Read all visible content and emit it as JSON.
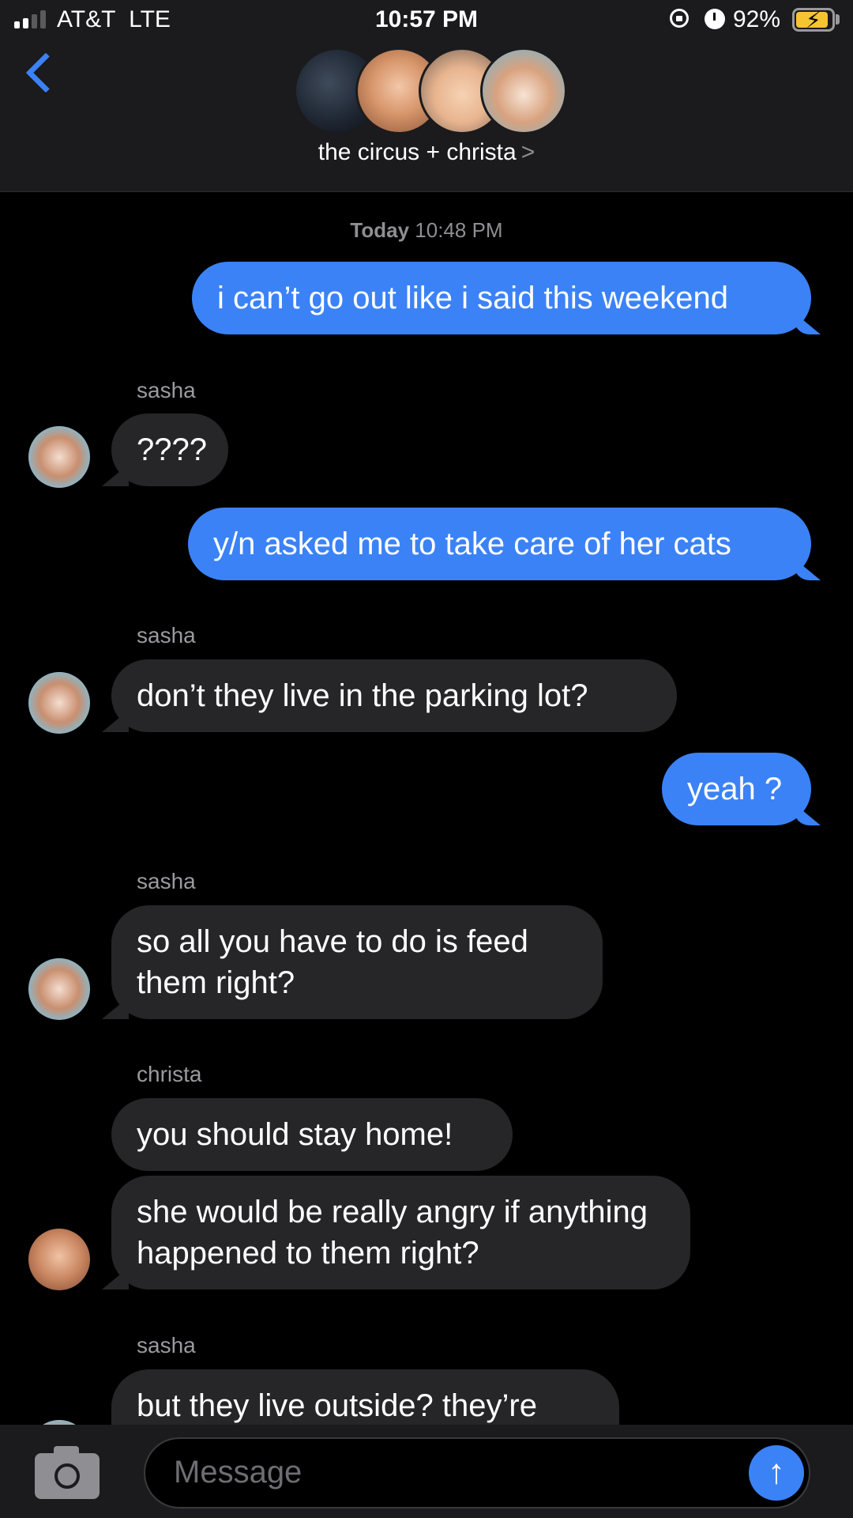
{
  "status_bar": {
    "carrier": "AT&T",
    "network": "LTE",
    "time": "10:57 PM",
    "battery_percent": "92%",
    "battery_level": 0.92,
    "battery_color": "#f5c531"
  },
  "header": {
    "back_icon": "chevron-left-icon",
    "group_name": "the circus + christa",
    "chevron": ">"
  },
  "thread": {
    "timestamp_day": "Today",
    "timestamp_time": "10:48 PM",
    "messages": [
      {
        "dir": "out",
        "text": "i can’t go out like i said this weekend"
      },
      {
        "dir": "in",
        "sender": "sasha",
        "text": "????"
      },
      {
        "dir": "out",
        "text": "y/n asked me to take care of her cats"
      },
      {
        "dir": "in",
        "sender": "sasha",
        "text": "don’t they live in the parking lot?"
      },
      {
        "dir": "out",
        "text": "yeah ?"
      },
      {
        "dir": "in",
        "sender": "sasha",
        "text": "so all you have to do is feed them right?"
      },
      {
        "dir": "in",
        "sender": "christa",
        "text": "you should stay home!"
      },
      {
        "dir": "in",
        "sender": "christa",
        "text": "she would be really angry if anything happened to them right?"
      },
      {
        "dir": "in",
        "sender": "sasha",
        "text": "but they live outside? they’re"
      }
    ]
  },
  "composer": {
    "placeholder": "Message",
    "camera_icon": "camera-icon",
    "send_icon": "arrow-up-icon"
  },
  "colors": {
    "outgoing_bubble": "#3b82f6",
    "incoming_bubble": "#262628",
    "background": "#000000"
  }
}
